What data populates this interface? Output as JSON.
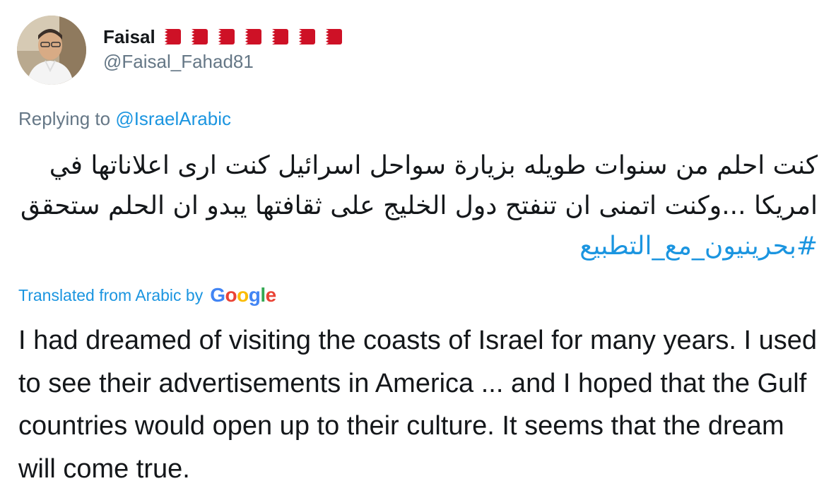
{
  "author": {
    "display_name": "Faisal",
    "handle": "@Faisal_Fahad81",
    "flag_count": 7,
    "flag_emoji": "bahrain-flag",
    "flag_color": "#ce1126"
  },
  "reply": {
    "prefix": "Replying to",
    "mention": "@IsraelArabic"
  },
  "original_text": {
    "body": "كنت احلم من سنوات طويله بزيارة سواحل اسرائيل كنت ارى اعلاناتها في امريكا ...وكنت اتمنى ان تنفتح دول الخليج على ثقافتها يبدو ان الحلم ستحقق",
    "hashtag": "#بحرينيون_مع_التطبيع"
  },
  "translation": {
    "label": "Translated from Arabic by",
    "provider": "Google",
    "text": "I had dreamed of visiting the coasts of Israel for many years. I used to see their advertisements in America ... and I hoped that the Gulf countries would open up to their culture. It seems that the dream will come true."
  },
  "colors": {
    "link": "#1b95e0",
    "secondary": "#657786",
    "primary_text": "#14171a"
  }
}
